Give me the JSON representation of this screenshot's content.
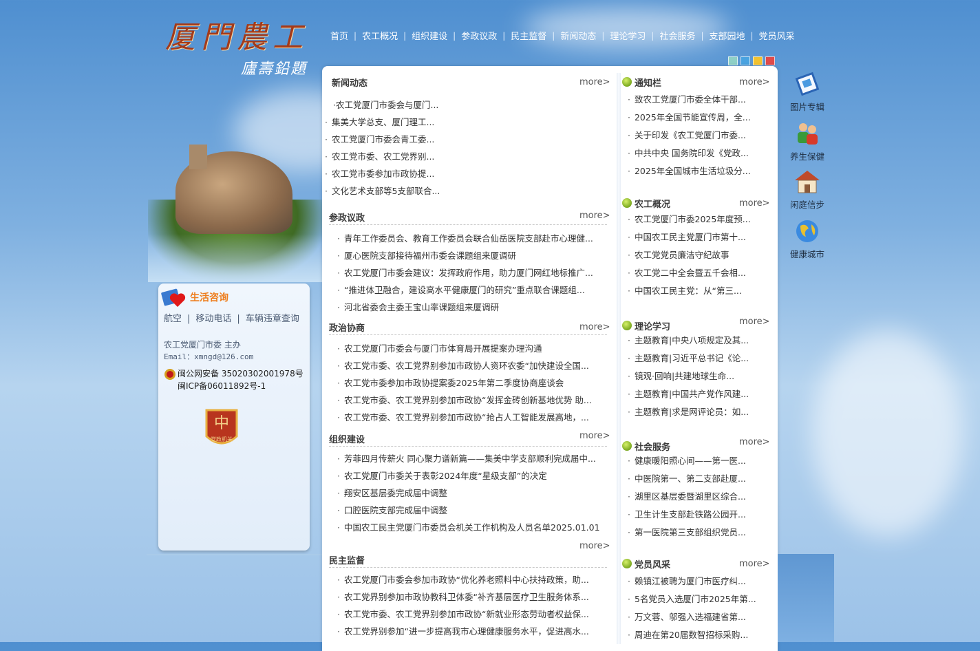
{
  "logo": {
    "main": "厦門農工",
    "sign": "廬壽鉛題"
  },
  "nav": [
    "首页",
    "农工概况",
    "组织建设",
    "参政议政",
    "民主监督",
    "新闻动态",
    "理论学习",
    "社会服务",
    "支部园地",
    "党员风采"
  ],
  "theme_colors": [
    "#8fd0c6",
    "#4aa3e0",
    "#f2c230",
    "#e04a4a"
  ],
  "left": {
    "title": "生活咨询",
    "links": [
      "航空",
      "移动电话",
      "车辆违章查询"
    ],
    "host": "农工党厦门市委 主办",
    "email": "Email：xmngd@126.com",
    "police": "闽公网安备 35020302001978号",
    "icp": "闽ICP备06011892号-1",
    "badge_text": "党政机关"
  },
  "more_label": "more>",
  "news": {
    "title": "新闻动态",
    "items": [
      "·农工党厦门市委会与厦门...",
      "集美大学总支、厦门理工...",
      "农工党厦门市委会青工委...",
      "农工党市委、农工党界别...",
      "农工党市委参加市政协提...",
      "文化艺术支部等5支部联合..."
    ]
  },
  "cyzz": {
    "title": "参政议政",
    "items": [
      "青年工作委员会、教育工作委员会联合仙岳医院支部赴市心理健...",
      "厦心医院支部接待福州市委会课题组来厦调研",
      "农工党厦门市委会建议：发挥政府作用，助力厦门网红地标推广...",
      "“推进体卫融合，建设高水平健康厦门的研究”重点联合课题组...",
      "河北省委会主委王宝山率课题组来厦调研"
    ]
  },
  "zzxs": {
    "title": "政治协商",
    "items": [
      "农工党厦门市委会与厦门市体育局开展提案办理沟通",
      "农工党市委、农工党界别参加市政协人资环农委“加快建设全国...",
      "农工党市委参加市政协提案委2025年第二季度协商座谈会",
      "农工党市委、农工党界别参加市政协“发挥金砖创新基地优势 助...",
      "农工党市委、农工党界别参加市政协“抢占人工智能发展高地，..."
    ]
  },
  "zzjs": {
    "title": "组织建设",
    "items": [
      "芳菲四月传薪火 同心聚力谱新篇——集美中学支部顺利完成届中...",
      "农工党厦门市委关于表彰2024年度“星级支部”的决定",
      "翔安区基层委完成届中调整",
      "口腔医院支部完成届中调整",
      "中国农工民主党厦门市委员会机关工作机构及人员名单2025.01.01"
    ]
  },
  "mzjd": {
    "title": "民主监督",
    "items": [
      "农工党厦门市委会参加市政协“优化养老照料中心扶持政策，助...",
      "农工党界别参加市政协教科卫体委“补齐基层医疗卫生服务体系...",
      "农工党市委、农工党界别参加市政协“新就业形态劳动者权益保...",
      "农工党界别参加“进一步提高我市心理健康服务水平，促进高水..."
    ]
  },
  "notice": {
    "title": "通知栏",
    "items": [
      "致农工党厦门市委全体干部...",
      "2025年全国节能宣传周，全...",
      "关于印发《农工党厦门市委...",
      "中共中央 国务院印发《党政...",
      "2025年全国城市生活垃圾分..."
    ]
  },
  "ngkk": {
    "title": "农工概况",
    "items": [
      "农工党厦门市委2025年度预...",
      "中国农工民主党厦门市第十...",
      "农工党党员廉洁守纪故事",
      "农工党二中全会暨五千会相...",
      "中国农工民主党：从“第三..."
    ]
  },
  "llxx": {
    "title": "理论学习",
    "items": [
      "主题教育|中央八项规定及其...",
      "主题教育|习近平总书记《论...",
      "镜观·回响|共建地球生命...",
      "主题教育|中国共产党作风建...",
      "主题教育|求是网评论员：如..."
    ]
  },
  "shfw": {
    "title": "社会服务",
    "items": [
      "健康暖阳照心间——第一医...",
      "中医院第一、第二支部赴厦...",
      "湖里区基层委暨湖里区综合...",
      "卫生计生支部赴铁路公园开...",
      "第一医院第三支部组织党员..."
    ]
  },
  "dyfc": {
    "title": "党员风采",
    "items": [
      "赖镇江被聘为厦门市医疗纠...",
      "5名党员入选厦门市2025年第...",
      "万文蓉、邬强入选福建省第...",
      "周迪在第20届数智招标采购..."
    ]
  },
  "side": [
    "图片专辑",
    "养生保健",
    "闲庭信步",
    "健康城市"
  ]
}
